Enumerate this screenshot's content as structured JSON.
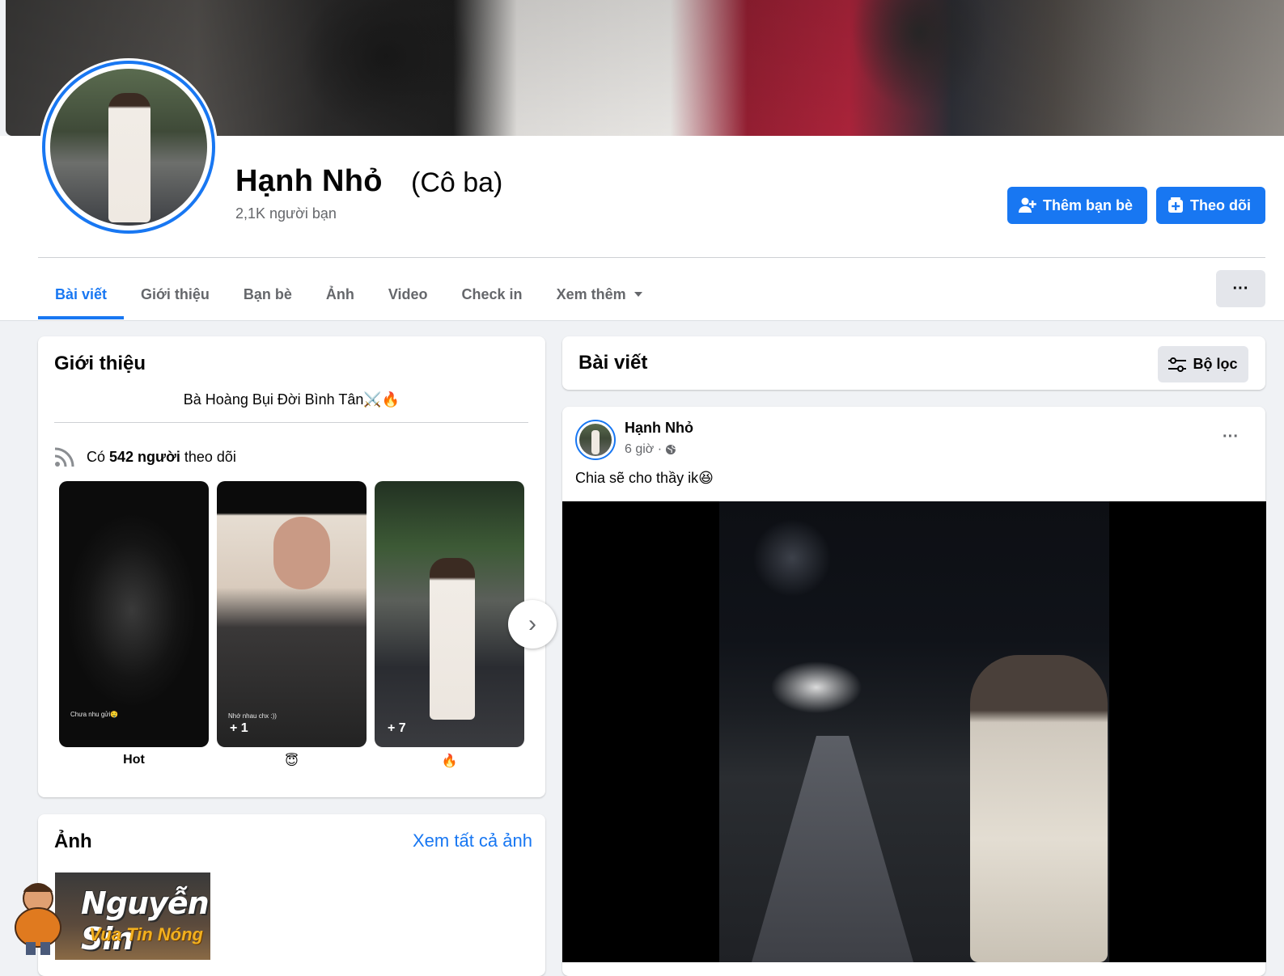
{
  "profile": {
    "name": "Hạnh Nhỏ",
    "alt_name": "(Cô ba)",
    "friends": "2,1K người bạn"
  },
  "actions": {
    "add_friend": "Thêm bạn bè",
    "follow": "Theo dõi",
    "more": "···"
  },
  "tabs": [
    {
      "label": "Bài viết",
      "active": true
    },
    {
      "label": "Giới thiệu"
    },
    {
      "label": "Bạn bè"
    },
    {
      "label": "Ảnh"
    },
    {
      "label": "Video"
    },
    {
      "label": "Check in"
    },
    {
      "label": "Xem thêm"
    }
  ],
  "intro": {
    "title": "Giới thiệu",
    "bio": "Bà Hoàng Bụi Đời Bình Tân⚔️🔥",
    "followers_prefix": "Có ",
    "followers_count": "542 người",
    "followers_suffix": " theo dõi",
    "highlights": [
      {
        "caption": "Hot",
        "inner_text": "Chưa nhu gửi🤤",
        "badge": ""
      },
      {
        "caption": "😇",
        "inner_text": "Nhớ nhau chx :))",
        "badge": "+ 1"
      },
      {
        "caption": "🔥",
        "inner_text": "",
        "badge": "+ 7"
      }
    ]
  },
  "photos": {
    "title": "Ảnh",
    "see_all": "Xem tất cả ảnh"
  },
  "posts_section": {
    "title": "Bài viết",
    "filter": "Bộ lọc"
  },
  "post": {
    "author": "Hạnh Nhỏ",
    "time": "6 giờ ·",
    "text": "Chia sẽ cho thầy ik😆",
    "menu": "···"
  },
  "watermark": {
    "name": "Nguyễn Sin",
    "tagline": "Vua Tin Nóng"
  },
  "colors": {
    "accent": "#1877f2",
    "background": "#f0f2f5",
    "secondary_text": "#65676b"
  }
}
